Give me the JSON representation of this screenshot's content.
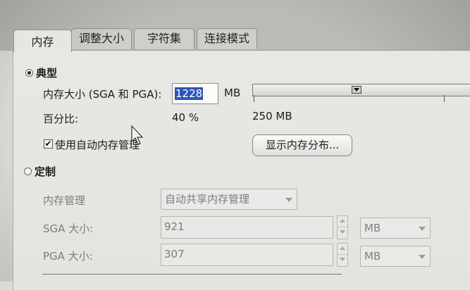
{
  "tabs": [
    {
      "label": "内存",
      "active": true
    },
    {
      "label": "调整大小",
      "active": false
    },
    {
      "label": "字符集",
      "active": false
    },
    {
      "label": "连接模式",
      "active": false
    }
  ],
  "typical": {
    "radio_label": "典型",
    "selected": true,
    "memory_size_label": "内存大小 (SGA 和 PGA):",
    "memory_size_value": "1228",
    "memory_unit": "MB",
    "slider_marker_label": "250 MB",
    "percent_label": "百分比:",
    "percent_value": "40 %",
    "auto_memory_checkbox_label": "使用自动内存管理",
    "auto_memory_checked": true,
    "show_distribution_button": "显示内存分布..."
  },
  "custom": {
    "radio_label": "定制",
    "selected": false,
    "memory_management_label": "内存管理",
    "memory_management_value": "自动共享内存管理",
    "sga_label": "SGA 大小:",
    "sga_value": "921",
    "sga_unit": "MB",
    "pga_label": "PGA 大小:",
    "pga_value": "307",
    "pga_unit": "MB"
  },
  "colors": {
    "selection": "#2d55b7",
    "disabled_text": "#7b7d7a"
  }
}
